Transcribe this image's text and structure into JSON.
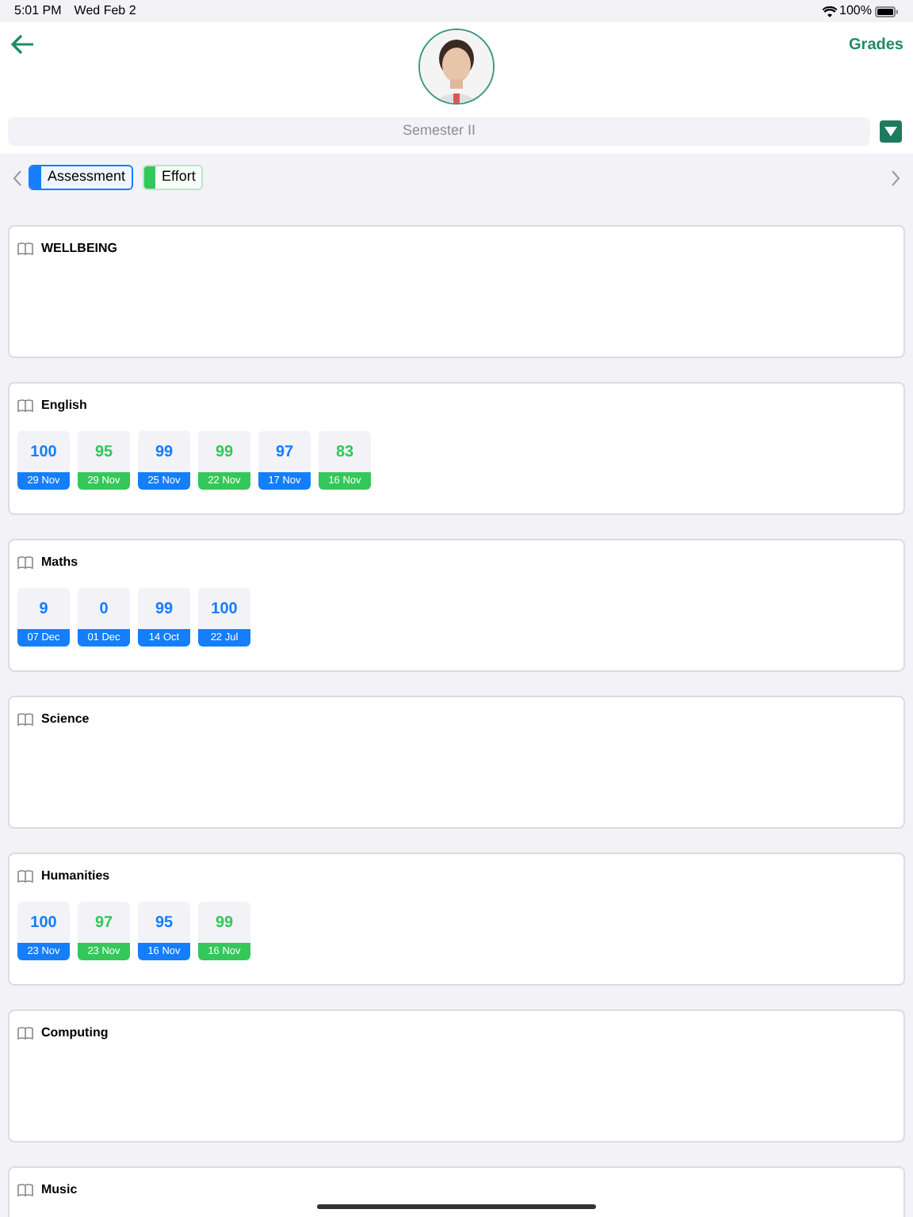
{
  "status_bar": {
    "time": "5:01 PM",
    "date": "Wed Feb 2",
    "battery": "100%"
  },
  "header": {
    "title": "Grades"
  },
  "semester": {
    "value": "Semester II"
  },
  "filters": [
    {
      "label": "Assessment",
      "kind": "assessment",
      "selected": true
    },
    {
      "label": "Effort",
      "kind": "effort",
      "selected": false
    }
  ],
  "subjects": [
    {
      "name": "WELLBEING"
    },
    {
      "name": "English",
      "grades": [
        {
          "score": "100",
          "date": "29 Nov",
          "kind": "assessment"
        },
        {
          "score": "95",
          "date": "29 Nov",
          "kind": "effort"
        },
        {
          "score": "99",
          "date": "25 Nov",
          "kind": "assessment"
        },
        {
          "score": "99",
          "date": "22 Nov",
          "kind": "effort"
        },
        {
          "score": "97",
          "date": "17 Nov",
          "kind": "assessment"
        },
        {
          "score": "83",
          "date": "16 Nov",
          "kind": "effort"
        }
      ]
    },
    {
      "name": "Maths",
      "grades": [
        {
          "score": "9",
          "date": "07 Dec",
          "kind": "assessment"
        },
        {
          "score": "0",
          "date": "01 Dec",
          "kind": "assessment"
        },
        {
          "score": "99",
          "date": "14 Oct",
          "kind": "assessment"
        },
        {
          "score": "100",
          "date": "22 Jul",
          "kind": "assessment"
        }
      ]
    },
    {
      "name": "Science"
    },
    {
      "name": "Humanities",
      "grades": [
        {
          "score": "100",
          "date": "23 Nov",
          "kind": "assessment"
        },
        {
          "score": "97",
          "date": "23 Nov",
          "kind": "effort"
        },
        {
          "score": "95",
          "date": "16 Nov",
          "kind": "assessment"
        },
        {
          "score": "99",
          "date": "16 Nov",
          "kind": "effort"
        }
      ]
    },
    {
      "name": "Computing"
    },
    {
      "name": "Music"
    }
  ]
}
